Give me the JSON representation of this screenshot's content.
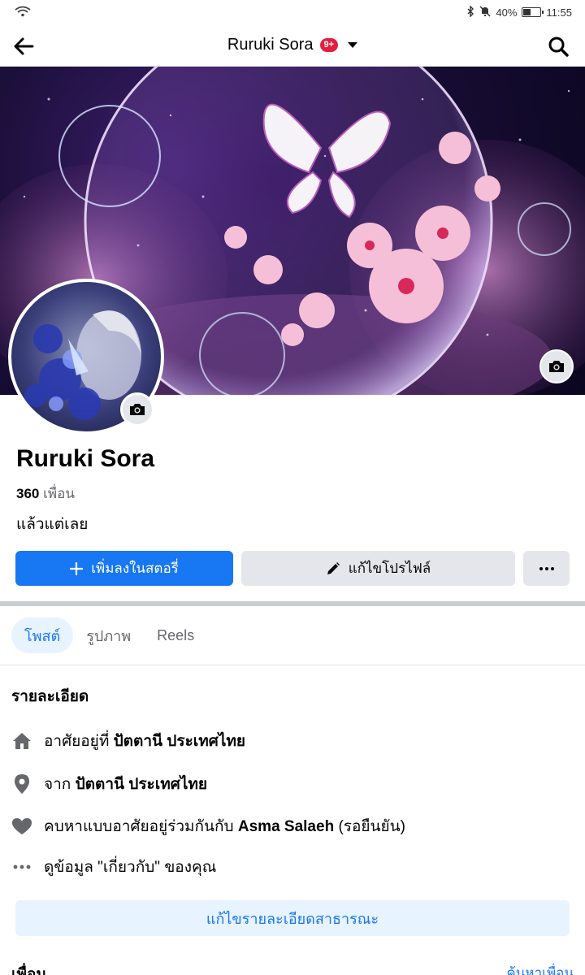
{
  "status_bar": {
    "battery_text": "40%",
    "time": "11:55",
    "battery_level": 0.4
  },
  "header": {
    "title": "Ruruki Sora",
    "badge": "9+"
  },
  "profile": {
    "name": "Ruruki Sora",
    "friends_count": "360",
    "friends_label": "เพื่อน",
    "bio": "แล้วแต่เลย"
  },
  "actions": {
    "add_story": "เพิ่มลงในสตอรี่",
    "edit_profile": "แก้ไขโปรไฟล์"
  },
  "tabs": [
    {
      "label": "โพสต์"
    },
    {
      "label": "รูปภาพ"
    },
    {
      "label": "Reels"
    }
  ],
  "details": {
    "title": "รายละเอียด",
    "lives_prefix": "อาศัยอยู่ที่",
    "lives_value": "ปัตตานี ประเทศไทย",
    "from_prefix": "จาก",
    "from_value": "ปัตตานี ประเทศไทย",
    "relationship_prefix": "คบหาแบบอาศัยอยู่ร่วมกันกับ",
    "relationship_partner": "Asma Salaeh",
    "relationship_status": "(รอยืนยัน)",
    "about_link": "ดูข้อมูล \"เกี่ยวกับ\" ของคุณ",
    "edit_public": "แก้ไขรายละเอียดสาธารณะ"
  },
  "friends_section": {
    "title": "เพื่อน",
    "find_link": "ค้นหาเพื่อน"
  },
  "icons": [
    "wifi-icon",
    "bluetooth-icon",
    "mute-icon",
    "battery-icon",
    "back-arrow-icon",
    "search-icon",
    "camera-icon",
    "plus-icon",
    "pencil-icon",
    "more-icon",
    "home-icon",
    "location-pin-icon",
    "heart-icon",
    "ellipsis-icon"
  ],
  "colors": {
    "accent": "#1877f2",
    "badge": "#e41e3f",
    "button_gray": "#e4e6eb",
    "light_blue": "#e7f3ff"
  }
}
